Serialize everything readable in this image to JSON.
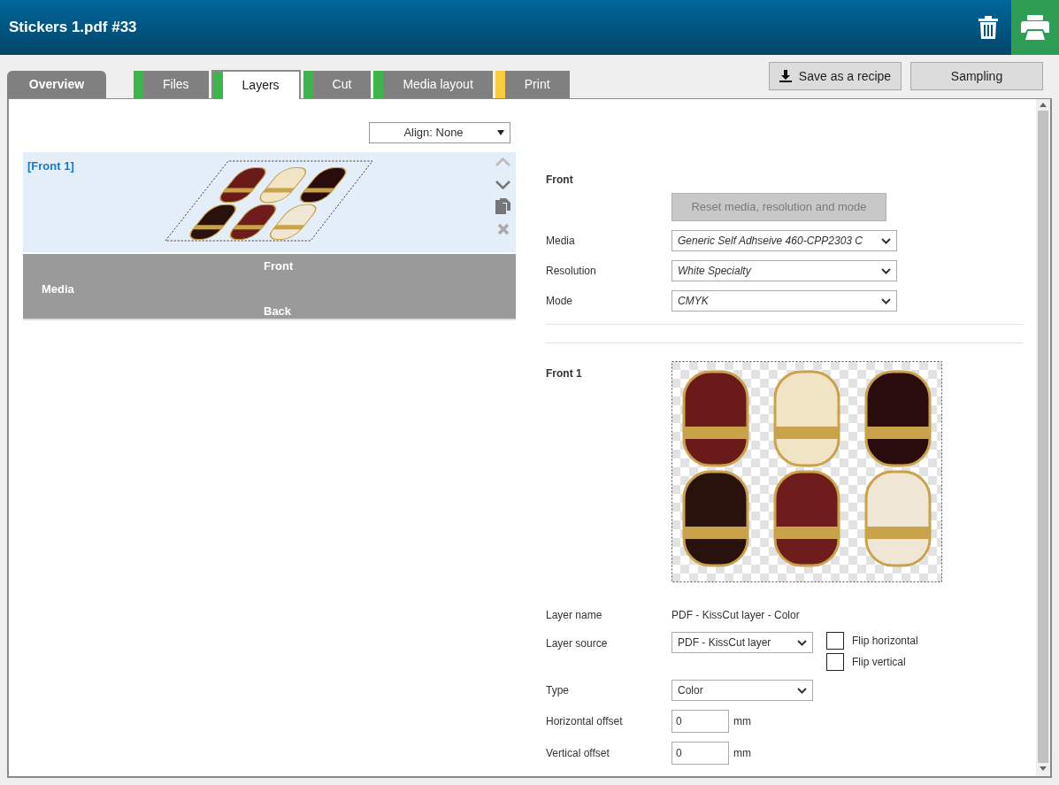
{
  "window": {
    "title": "Stickers 1.pdf #33"
  },
  "tabs": [
    {
      "label": "Overview",
      "selected": false
    },
    {
      "label": "Files",
      "selected": false,
      "color": "#3cb54a"
    },
    {
      "label": "Layers",
      "selected": true,
      "color": "#3cb54a"
    },
    {
      "label": "Cut",
      "selected": false,
      "color": "#3cb54a"
    },
    {
      "label": "Media layout",
      "selected": false,
      "color": "#3cb54a"
    },
    {
      "label": "Print",
      "selected": false,
      "color": "#f8cc3c"
    }
  ],
  "actions": [
    "Save as a recipe",
    "Sampling"
  ],
  "align": {
    "value": "Align: None"
  },
  "layers": [
    {
      "label": "[Front 1]",
      "selected": true
    }
  ],
  "media_bar": {
    "label": "Media",
    "sides": [
      "Front",
      "Back"
    ]
  },
  "front": {
    "heading": "Front",
    "reset_button": {
      "label": "Reset media, resolution and mode",
      "disabled": true
    },
    "fields": [
      {
        "label": "Media",
        "value": "Generic Self Adhseive 460-CPP2303 C"
      },
      {
        "label": "Resolution",
        "value": "White Specialty"
      },
      {
        "label": "Mode",
        "value": "CMYK"
      }
    ]
  },
  "layer": {
    "heading": "Front 1",
    "name_label": "Layer name",
    "name_value": "PDF - KissCut layer - Color",
    "source": {
      "label": "Layer source",
      "value": "PDF - KissCut layer"
    },
    "flips": [
      {
        "label": "Flip horizontal",
        "checked": false
      },
      {
        "label": "Flip vertical",
        "checked": false
      }
    ],
    "type": {
      "label": "Type",
      "value": "Color"
    },
    "offsets": [
      {
        "label": "Horizontal offset",
        "value": "0",
        "unit": "mm"
      },
      {
        "label": "Vertical offset",
        "value": "0",
        "unit": "mm"
      }
    ]
  }
}
